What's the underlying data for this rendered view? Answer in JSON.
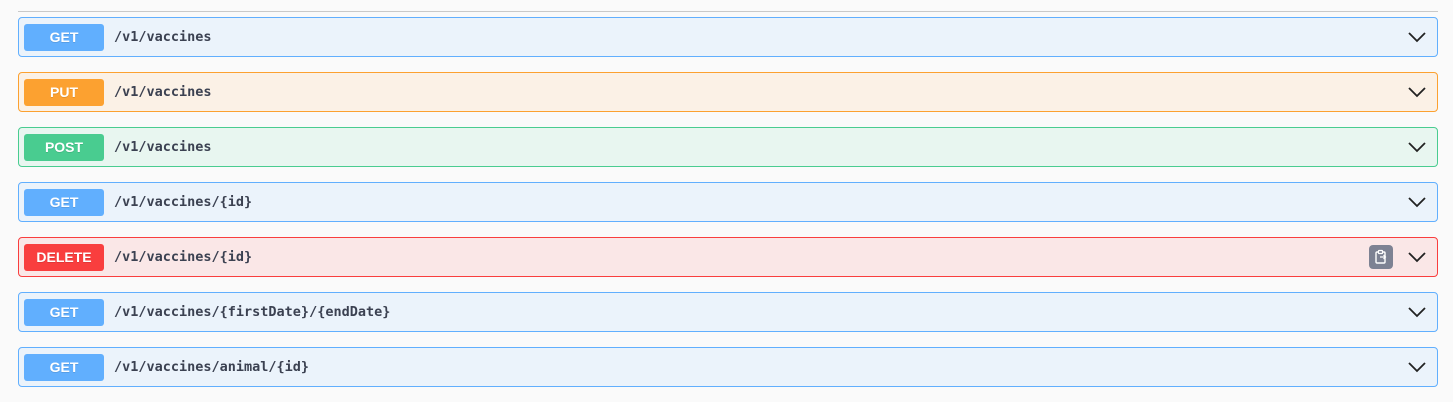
{
  "operations": [
    {
      "method": "GET",
      "path": "/v1/vaccines"
    },
    {
      "method": "PUT",
      "path": "/v1/vaccines"
    },
    {
      "method": "POST",
      "path": "/v1/vaccines"
    },
    {
      "method": "GET",
      "path": "/v1/vaccines/{id}"
    },
    {
      "method": "DELETE",
      "path": "/v1/vaccines/{id}",
      "copy_icon": "clipboard-icon"
    },
    {
      "method": "GET",
      "path": "/v1/vaccines/{firstDate}/{endDate}"
    },
    {
      "method": "GET",
      "path": "/v1/vaccines/animal/{id}"
    }
  ],
  "colors": {
    "get": "#61affe",
    "put": "#fca130",
    "post": "#49cc90",
    "delete": "#f93e3e",
    "path_text": "#3b4151"
  },
  "icons": {
    "expand": "chevron-down-icon",
    "copy": "clipboard-icon"
  }
}
